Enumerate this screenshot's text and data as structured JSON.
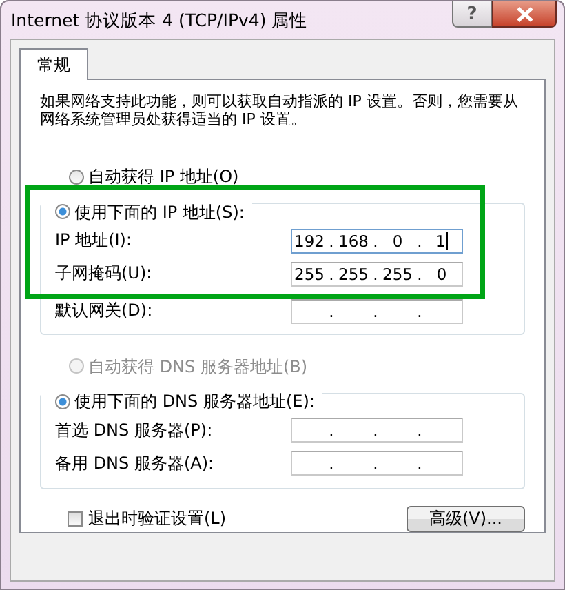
{
  "window": {
    "title": "Internet 协议版本 4 (TCP/IPv4) 属性",
    "help_button": "?"
  },
  "tabs": [
    {
      "label": "常规",
      "selected": true
    }
  ],
  "description": "如果网络支持此功能，则可以获取自动指派的 IP 设置。否则，您需要从网络系统管理员处获得适当的 IP 设置。",
  "ip_mode": [
    {
      "label": "自动获得 IP 地址(O)",
      "selected": false,
      "disabled": false
    },
    {
      "label": "使用下面的 IP 地址(S):",
      "selected": true,
      "disabled": false
    }
  ],
  "ip_fields": [
    {
      "label": "IP 地址(I):",
      "separator": ".",
      "octets": [
        "192",
        "168",
        "0",
        "1"
      ],
      "focused": true
    },
    {
      "label": "子网掩码(U):",
      "separator": ".",
      "octets": [
        "255",
        "255",
        "255",
        "0"
      ],
      "focused": false
    },
    {
      "label": "默认网关(D):",
      "separator": ".",
      "focused": false
    }
  ],
  "dns_mode": [
    {
      "label": "自动获得 DNS 服务器地址(B)",
      "selected": false,
      "disabled": true
    },
    {
      "label": "使用下面的 DNS 服务器地址(E):",
      "selected": true,
      "disabled": false
    }
  ],
  "dns_fields": [
    {
      "label": "首选 DNS 服务器(P):",
      "separator": ".",
      "focused": false
    },
    {
      "label": "备用 DNS 服务器(A):",
      "separator": ".",
      "focused": false
    }
  ],
  "validate_on_exit": {
    "label": "退出时验证设置(L)",
    "checked": false
  },
  "advanced_button": "高级(V)..."
}
